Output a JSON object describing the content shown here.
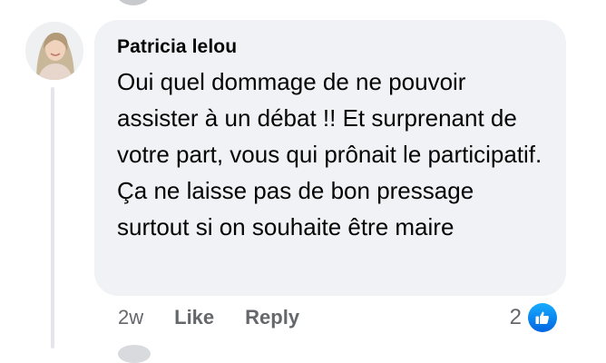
{
  "comment": {
    "author": "Patricia lelou",
    "text": "Oui quel dommage de ne pouvoir assister à un débat !! Et surprenant de votre part, vous qui prônait le participatif. Ça ne laisse pas de bon pressage surtout si on souhaite être maire",
    "timestamp": "2w",
    "actions": {
      "like": "Like",
      "reply": "Reply"
    },
    "reactions": {
      "count": "2",
      "type": "like-icon"
    }
  },
  "colors": {
    "bubble": "#f0f2f5",
    "text": "#050505",
    "meta": "#65676b",
    "like_blue": "#1877f2"
  }
}
